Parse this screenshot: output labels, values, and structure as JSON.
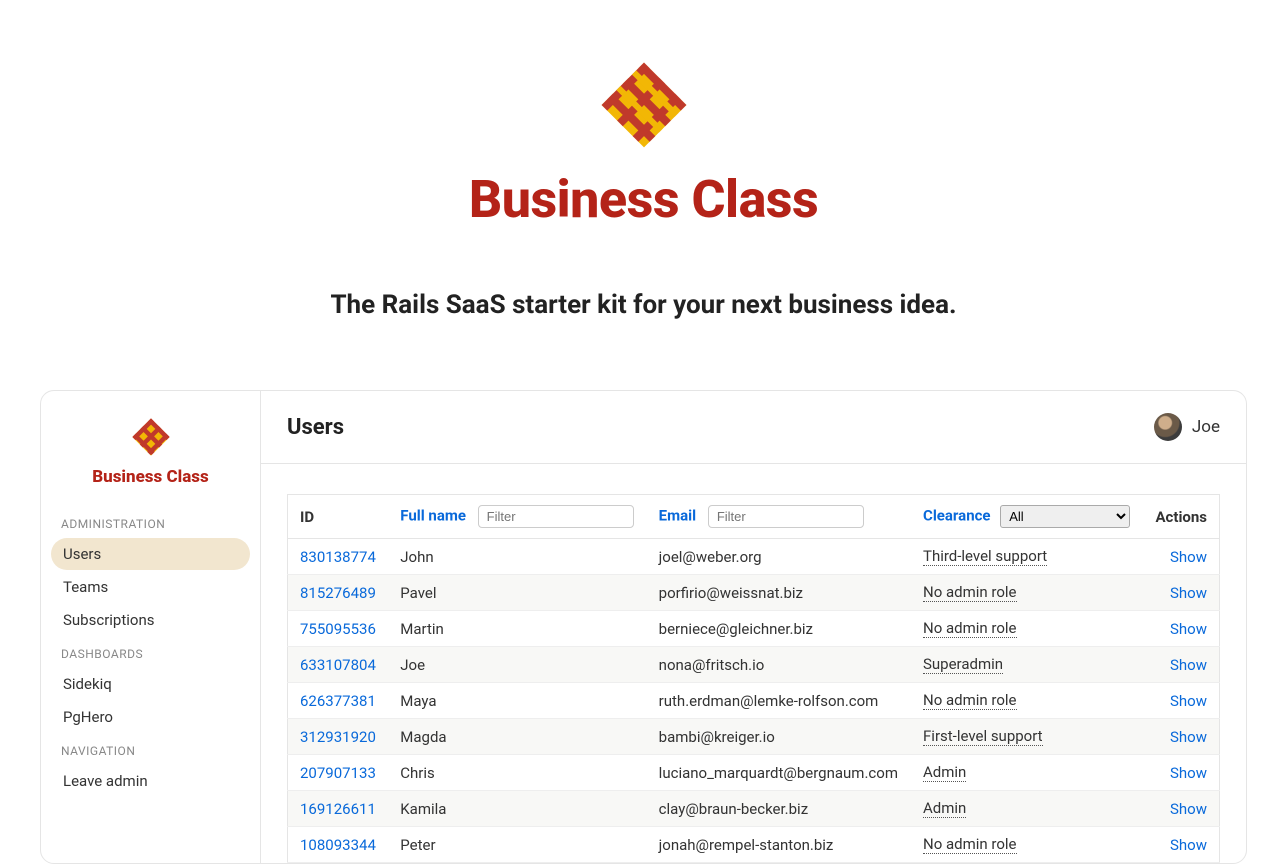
{
  "hero": {
    "title": "Business Class",
    "subtitle": "The Rails SaaS starter kit for your next business idea."
  },
  "sidebar": {
    "brand": "Business Class",
    "sections": [
      {
        "label": "ADMINISTRATION",
        "items": [
          {
            "label": "Users",
            "active": true
          },
          {
            "label": "Teams",
            "active": false
          },
          {
            "label": "Subscriptions",
            "active": false
          }
        ]
      },
      {
        "label": "DASHBOARDS",
        "items": [
          {
            "label": "Sidekiq",
            "active": false
          },
          {
            "label": "PgHero",
            "active": false
          }
        ]
      },
      {
        "label": "NAVIGATION",
        "items": [
          {
            "label": "Leave admin",
            "active": false
          }
        ]
      }
    ]
  },
  "header": {
    "title": "Users",
    "current_user": "Joe"
  },
  "table": {
    "columns": {
      "id": "ID",
      "full_name": "Full name",
      "email": "Email",
      "clearance": "Clearance",
      "actions": "Actions"
    },
    "filters": {
      "name_placeholder": "Filter",
      "email_placeholder": "Filter",
      "clearance_selected": "All",
      "clearance_options": [
        "All"
      ]
    },
    "action_label": "Show",
    "rows": [
      {
        "id": "830138774",
        "name": "John",
        "email": "joel@weber.org",
        "clearance": "Third-level support"
      },
      {
        "id": "815276489",
        "name": "Pavel",
        "email": "porfirio@weissnat.biz",
        "clearance": "No admin role"
      },
      {
        "id": "755095536",
        "name": "Martin",
        "email": "berniece@gleichner.biz",
        "clearance": "No admin role"
      },
      {
        "id": "633107804",
        "name": "Joe",
        "email": "nona@fritsch.io",
        "clearance": "Superadmin"
      },
      {
        "id": "626377381",
        "name": "Maya",
        "email": "ruth.erdman@lemke-rolfson.com",
        "clearance": "No admin role"
      },
      {
        "id": "312931920",
        "name": "Magda",
        "email": "bambi@kreiger.io",
        "clearance": "First-level support"
      },
      {
        "id": "207907133",
        "name": "Chris",
        "email": "luciano_marquardt@bergnaum.com",
        "clearance": "Admin"
      },
      {
        "id": "169126611",
        "name": "Kamila",
        "email": "clay@braun-becker.biz",
        "clearance": "Admin"
      },
      {
        "id": "108093344",
        "name": "Peter",
        "email": "jonah@rempel-stanton.biz",
        "clearance": "No admin role"
      }
    ]
  }
}
